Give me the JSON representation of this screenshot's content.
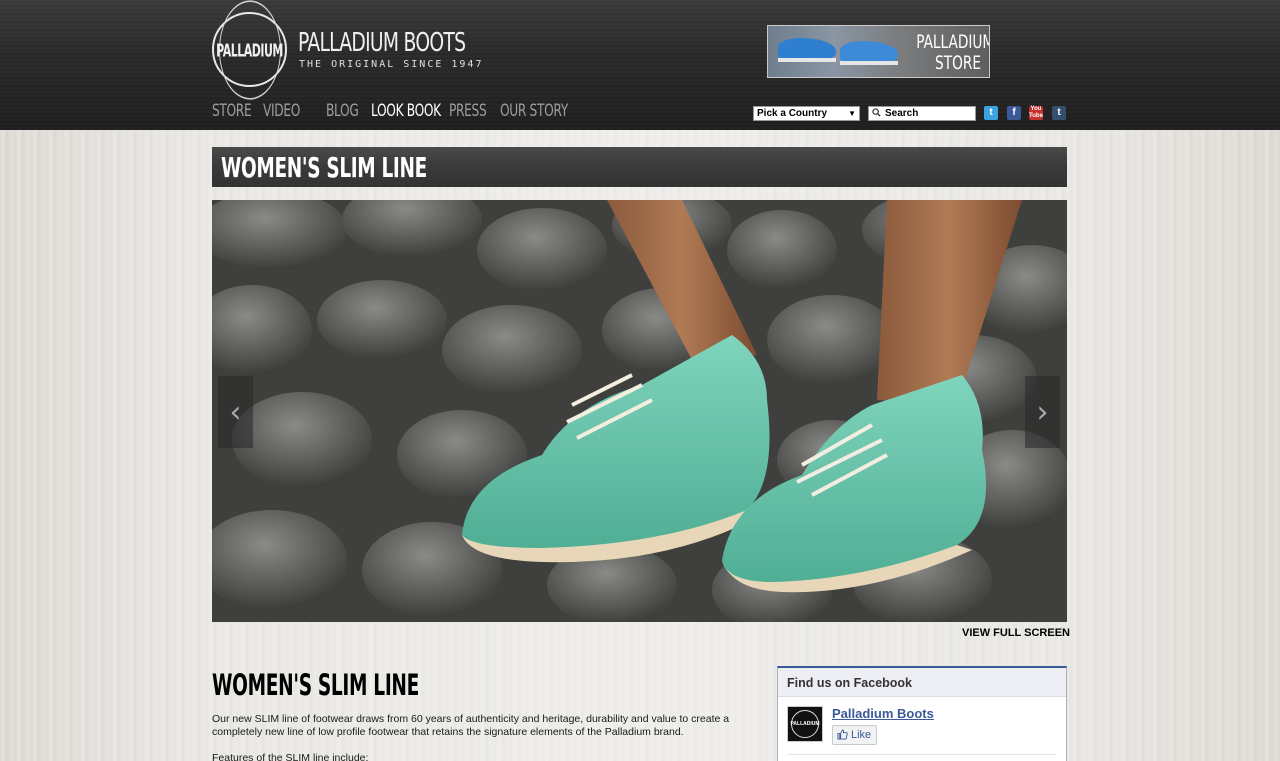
{
  "header": {
    "logo_text": "PALLADIUM",
    "brand_name": "PALLADIUM BOOTS",
    "tagline": "THE ORIGINAL SINCE 1947",
    "store_banner_label": "PALLADIUM STORE",
    "nav": [
      {
        "label": "STORE",
        "active": false
      },
      {
        "label": "VIDEO",
        "active": false
      },
      {
        "label": "BLOG",
        "active": false
      },
      {
        "label": "LOOK BOOK",
        "active": true
      },
      {
        "label": "PRESS",
        "active": false
      },
      {
        "label": "OUR STORY",
        "active": false
      }
    ],
    "country_select": "Pick a Country",
    "search_placeholder": "Search",
    "social_icons": [
      "twitter-icon",
      "facebook-icon",
      "youtube-icon",
      "tumblr-icon"
    ]
  },
  "page": {
    "title": "WOMEN'S SLIM LINE",
    "view_full_screen": "VIEW FULL SCREEN",
    "section_title": "WOMEN'S SLIM LINE",
    "description": "Our new SLIM line of footwear draws from 60 years of authenticity and heritage, durability and value to create a completely new line of low profile footwear that retains the signature elements of the Palladium brand.",
    "features_intro": "Features of the SLIM line include:"
  },
  "facebook": {
    "heading": "Find us on Facebook",
    "page_name": "Palladium Boots",
    "like_label": "Like"
  },
  "colors": {
    "shoe": "#5fc2a8",
    "facebook_blue": "#3b5998",
    "nav_inactive": "#9d9d9d"
  }
}
